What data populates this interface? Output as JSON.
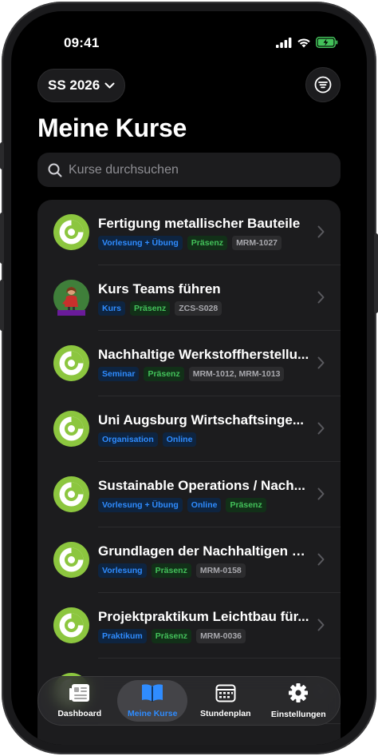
{
  "status_bar": {
    "time": "09:41"
  },
  "header": {
    "semester": "SS 2026",
    "title": "Meine Kurse"
  },
  "search": {
    "placeholder": "Kurse durchsuchen"
  },
  "courses": [
    {
      "title": "Fertigung metallischer Bauteile",
      "avatar": "logo",
      "tags": [
        {
          "text": "Vorlesung + Übung",
          "color": "blue"
        },
        {
          "text": "Präsenz",
          "color": "green"
        },
        {
          "text": "MRM-1027",
          "color": "gray"
        }
      ]
    },
    {
      "title": "Kurs Teams führen",
      "avatar": "person",
      "tags": [
        {
          "text": "Kurs",
          "color": "blue"
        },
        {
          "text": "Präsenz",
          "color": "green"
        },
        {
          "text": "ZCS-S028",
          "color": "gray"
        }
      ]
    },
    {
      "title": "Nachhaltige Werkstoffherstellu...",
      "avatar": "logo",
      "tags": [
        {
          "text": "Seminar",
          "color": "blue"
        },
        {
          "text": "Präsenz",
          "color": "green"
        },
        {
          "text": "MRM-1012, MRM-1013",
          "color": "gray"
        }
      ]
    },
    {
      "title": "Uni Augsburg Wirtschaftsinge...",
      "avatar": "logo",
      "tags": [
        {
          "text": "Organisation",
          "color": "blue"
        },
        {
          "text": "Online",
          "color": "blue"
        }
      ]
    },
    {
      "title": "Sustainable Operations / Nach...",
      "avatar": "logo",
      "tags": [
        {
          "text": "Vorlesung + Übung",
          "color": "blue"
        },
        {
          "text": "Online",
          "color": "blue"
        },
        {
          "text": "Präsenz",
          "color": "green"
        }
      ]
    },
    {
      "title": "Grundlagen der Nachhaltigen E...",
      "avatar": "logo",
      "tags": [
        {
          "text": "Vorlesung",
          "color": "blue"
        },
        {
          "text": "Präsenz",
          "color": "green"
        },
        {
          "text": "MRM-0158",
          "color": "gray"
        }
      ]
    },
    {
      "title": "Projektpraktikum Leichtbau für...",
      "avatar": "logo",
      "tags": [
        {
          "text": "Praktikum",
          "color": "blue"
        },
        {
          "text": "Präsenz",
          "color": "green"
        },
        {
          "text": "MRM-0036",
          "color": "gray"
        }
      ]
    },
    {
      "title": "",
      "avatar": "logo",
      "tags": []
    }
  ],
  "tabs": [
    {
      "label": "Dashboard",
      "icon": "dashboard-icon",
      "active": false
    },
    {
      "label": "Meine Kurse",
      "icon": "book-icon",
      "active": true
    },
    {
      "label": "Stundenplan",
      "icon": "calendar-icon",
      "active": false
    },
    {
      "label": "Einstellungen",
      "icon": "gear-icon",
      "active": false
    }
  ],
  "colors": {
    "accent_blue": "#2f8cff",
    "accent_green": "#43c15a",
    "logo_green": "#8cc63f",
    "background": "#000000",
    "surface": "#1c1c1e"
  }
}
